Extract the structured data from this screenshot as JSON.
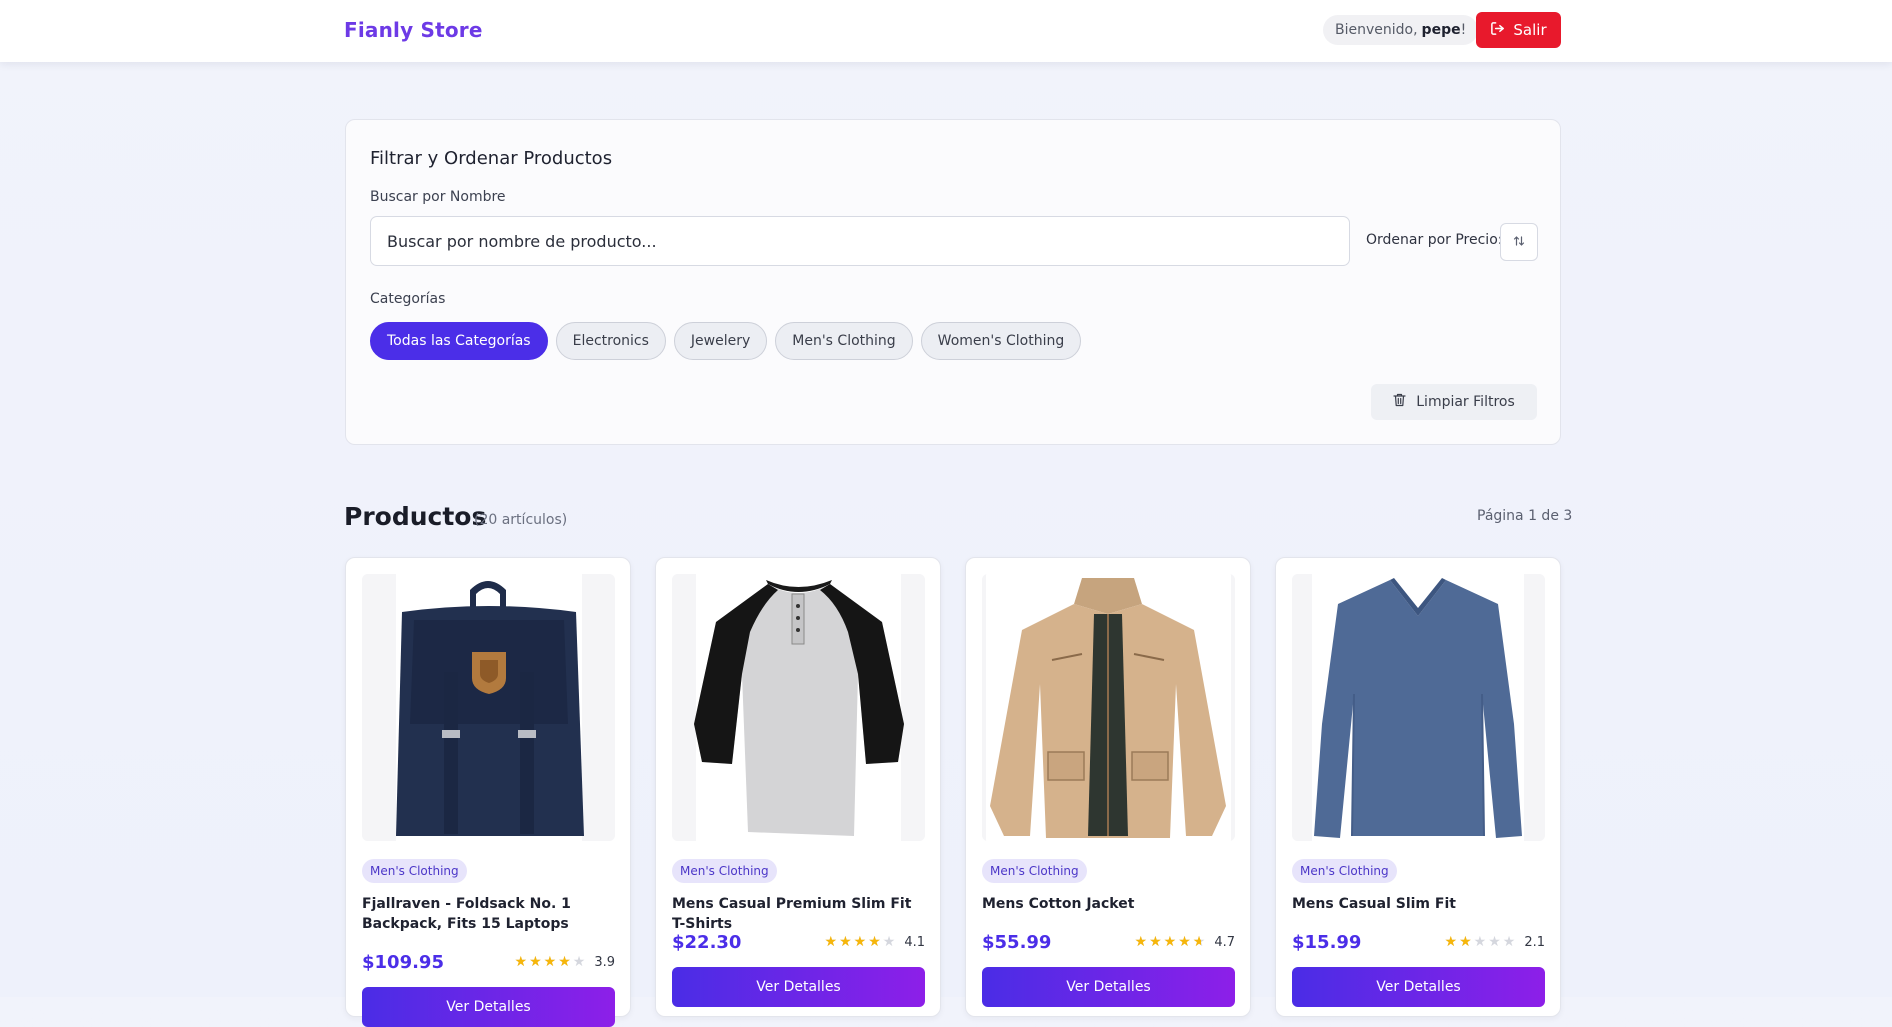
{
  "header": {
    "brand": "Fianly Store",
    "welcome_prefix": "Bienvenido,",
    "welcome_user": "pepe",
    "welcome_suffix": "!",
    "logout_label": "Salir"
  },
  "filters": {
    "title": "Filtrar y Ordenar Productos",
    "search_label": "Buscar por Nombre",
    "search_placeholder": "Buscar por nombre de producto...",
    "sort_label": "Ordenar por Precio:",
    "sort_icon": "sort-arrows-icon",
    "categories_label": "Categorías",
    "categories": [
      {
        "label": "Todas las Categorías",
        "active": true
      },
      {
        "label": "Electronics",
        "active": false
      },
      {
        "label": "Jewelery",
        "active": false
      },
      {
        "label": "Men's Clothing",
        "active": false
      },
      {
        "label": "Women's Clothing",
        "active": false
      }
    ],
    "clear_label": "Limpiar Filtros"
  },
  "products": {
    "title": "Productos",
    "count": "(20 artículos)",
    "page_info": "Página 1 de 3",
    "button_label": "Ver Detalles",
    "items": [
      {
        "category": "Men's Clothing",
        "name": "Fjallraven - Foldsack No. 1 Backpack, Fits 15 Laptops",
        "price": "$109.95",
        "rating": "3.9",
        "image_icon": "backpack-icon"
      },
      {
        "category": "Men's Clothing",
        "name": "Mens Casual Premium Slim Fit T-Shirts",
        "price": "$22.30",
        "rating": "4.1",
        "image_icon": "raglan-tshirt-icon"
      },
      {
        "category": "Men's Clothing",
        "name": "Mens Cotton Jacket",
        "price": "$55.99",
        "rating": "4.7",
        "image_icon": "jacket-icon"
      },
      {
        "category": "Men's Clothing",
        "name": "Mens Casual Slim Fit",
        "price": "$15.99",
        "rating": "2.1",
        "image_icon": "longsleeve-shirt-icon"
      }
    ]
  },
  "colors": {
    "brand": "#6d3ae6",
    "accent": "#4b2ee8",
    "logout": "#e8192c",
    "star": "#f6b60b"
  }
}
